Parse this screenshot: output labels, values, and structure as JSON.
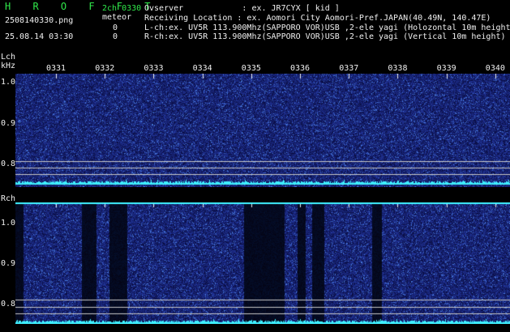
{
  "header": {
    "app_title": "H R O F F T",
    "channel_time": "2ch 0330",
    "filename": "2508140330.png",
    "meteor_label": "meteor",
    "meteor_count_l": "0",
    "datetime": "25.08.14 03:30",
    "meteor_count_r": "0",
    "observer_line": "Ovserver            : ex. JR7CYX [ kid ]",
    "location_line": "Receiving Location : ex. Aomori City Aomori-Pref.JAPAN(40.49N, 140.47E)",
    "lch_line": "L-ch:ex. UV5R 113.900Mhz(SAPPORO VOR)USB ,2-ele yagi (Holozontal 10m height)",
    "rch_line": "R-ch:ex. UV5R 113.900Mhz(SAPPORO VOR)USB ,2-ele yagi (Vertical 10m height)"
  },
  "time_axis": {
    "labels": [
      "0331",
      "0332",
      "0333",
      "0334",
      "0335",
      "0336",
      "0337",
      "0338",
      "0339",
      "0340"
    ]
  },
  "lch_panel": {
    "label": "Lch",
    "unit": "kHz",
    "y_ticks": [
      "1.0",
      "0.9",
      "0.8"
    ]
  },
  "rch_panel": {
    "label": "Rch",
    "y_ticks": [
      "1.0",
      "0.9",
      "0.8"
    ]
  },
  "colors": {
    "text_green": "#30e84a",
    "text_white": "#f0f0f0",
    "background": "#000000",
    "spectrogram_base": "#0a0a4a",
    "signal_cyan": "#3ff0ff"
  }
}
